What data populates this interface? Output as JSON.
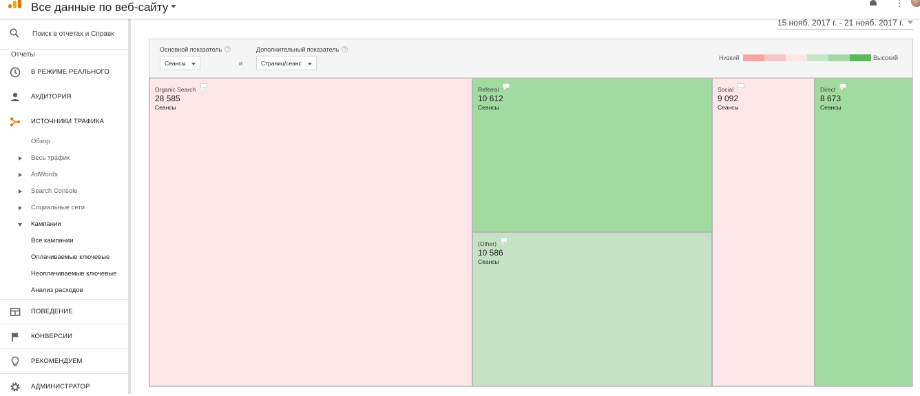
{
  "app": {
    "title": "Все данные по веб-сайту"
  },
  "sidebar": {
    "search_placeholder": "Поиск в отчетах и Справк",
    "section_label": "Отчеты",
    "main_items": [
      {
        "label": "В РЕЖИМЕ РЕАЛЬНОГО",
        "icon": "clock-icon"
      },
      {
        "label": "АУДИТОРИЯ",
        "icon": "person-icon"
      },
      {
        "label": "ИСТОЧНИКИ ТРАФИКА",
        "icon": "acquisition-icon",
        "color": "#e37400"
      },
      {
        "label": "ПОВЕДЕНИЕ",
        "icon": "behavior-icon"
      },
      {
        "label": "КОНВЕРСИИ",
        "icon": "flag-icon"
      },
      {
        "label": "РЕКОМЕНДУЕМ",
        "icon": "lightbulb-icon"
      },
      {
        "label": "АДМИНИСТРАТОР",
        "icon": "gear-icon"
      }
    ],
    "sub_items": [
      {
        "label": "Обзор"
      },
      {
        "label": "Весь трафик"
      },
      {
        "label": "AdWords"
      },
      {
        "label": "Search Console"
      },
      {
        "label": "Социальные сети"
      },
      {
        "label": "Кампании"
      },
      {
        "label": "Все кампании"
      },
      {
        "label": "Оплачиваемые ключевые"
      },
      {
        "label": "Неоплачиваемые ключевые"
      },
      {
        "label": "Анализ расходов"
      }
    ]
  },
  "date_range": "15 нояб. 2017 г. - 21 нояб. 2017 г.",
  "controls": {
    "primary_label": "Основной показатель",
    "primary_value": "Сеансы",
    "and_text": "и",
    "secondary_label": "Дополнительный показатель",
    "secondary_value": "Страниц/сеанс",
    "help_glyph": "?",
    "legend_low": "Низкий",
    "legend_high": "Высокий",
    "legend_colors": [
      "#f4a6a6",
      "#f7c6c6",
      "#fde8e8",
      "#c8e6c9",
      "#a5d6a7",
      "#5cb85c"
    ]
  },
  "treemap": {
    "metric_label": "Сеансы",
    "tiles": [
      {
        "name": "Organic Search",
        "value": "28 585",
        "color": "#fde7e8"
      },
      {
        "name": "Referral",
        "value": "10 612",
        "color": "#a2dba0"
      },
      {
        "name": "(Other)",
        "value": "10 586",
        "color": "#c5e3c4"
      },
      {
        "name": "Social",
        "value": "9 092",
        "color": "#fde7e8"
      },
      {
        "name": "Direct",
        "value": "8 673",
        "color": "#a2dba0"
      }
    ]
  }
}
